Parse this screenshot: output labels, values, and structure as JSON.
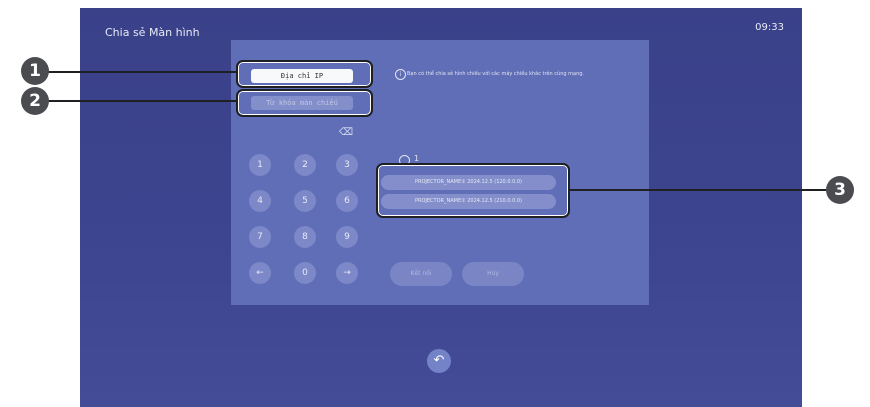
{
  "header": {
    "title": "Chia sẻ Màn hình",
    "time": "09:33"
  },
  "inputs": {
    "ip_label": "Địa chỉ IP",
    "key_placeholder": "Từ khóa màn chiếu"
  },
  "keypad": {
    "keys": [
      "1",
      "2",
      "3",
      "4",
      "5",
      "6",
      "7",
      "8",
      "9",
      "←",
      "0",
      "→"
    ]
  },
  "info_text": "Bạn có thể chia sẻ hình chiếu với các máy chiếu khác trên cùng mạng.",
  "projector_count": "1",
  "projectors": [
    "PROJECTOR_NAME① 2024.12.5 (120.0.0.0)",
    "PROJECTOR_NAME① 2024.12.5 (210.0.0.0)"
  ],
  "actions": {
    "connect": "Kết nối",
    "cancel": "Hủy"
  },
  "callouts": {
    "c1": "1",
    "c2": "2",
    "c3": "3"
  }
}
